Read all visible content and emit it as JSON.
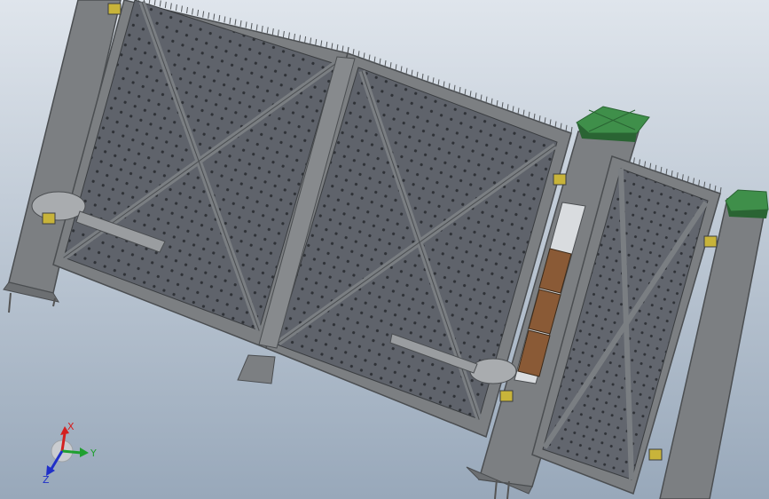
{
  "viewport": {
    "background_top": "#dfe5ec",
    "background_bottom": "#98a8ba"
  },
  "model": {
    "frame_color": "#7c7f82",
    "frame_dark": "#4b4e51",
    "panel_color": "#5f636b",
    "perforation_color": "#2f3237",
    "cap_color": "#3f8f4a",
    "cap_dark": "#2a6433",
    "hinge_color": "#c8b43a",
    "door_color": "#8a5a36"
  },
  "triad": {
    "x_label": "X",
    "y_label": "Y",
    "z_label": "Z",
    "x_color": "#d42020",
    "y_color": "#20a030",
    "z_color": "#2030c8"
  }
}
